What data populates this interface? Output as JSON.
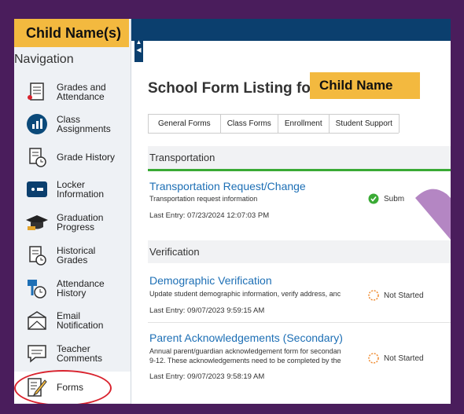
{
  "child_badge": "Child Name(s)",
  "nav": {
    "title": "Navigation",
    "items": [
      {
        "label": "Grades and Attendance",
        "icon": "grades-icon"
      },
      {
        "label": "Class Assignments",
        "icon": "class-assignments-icon"
      },
      {
        "label": "Grade History",
        "icon": "grade-history-icon"
      },
      {
        "label": "Locker Information",
        "icon": "locker-icon"
      },
      {
        "label": "Graduation Progress",
        "icon": "graduation-icon"
      },
      {
        "label": "Historical Grades",
        "icon": "historical-grades-icon"
      },
      {
        "label": "Attendance History",
        "icon": "attendance-history-icon"
      },
      {
        "label": "Email Notification",
        "icon": "email-icon"
      },
      {
        "label": "Teacher Comments",
        "icon": "comments-icon"
      },
      {
        "label": "Forms",
        "icon": "forms-icon",
        "active": true
      }
    ]
  },
  "page": {
    "title": "School Form Listing for",
    "child_name": "Child Name"
  },
  "tabs": [
    "General Forms",
    "Class Forms",
    "Enrollment",
    "Student Support"
  ],
  "sections": [
    {
      "name": "Transportation"
    },
    {
      "name": "Verification"
    }
  ],
  "forms": [
    {
      "title": "Transportation Request/Change",
      "desc": "Transportation request information",
      "last_entry": "Last Entry: 07/23/2024 12:07:03 PM",
      "status": "Subm"
    },
    {
      "title": "Demographic Verification",
      "desc": "Update student demographic information, verify address, anc",
      "last_entry": "Last Entry: 09/07/2023 9:59:15 AM",
      "status": "Not Started"
    },
    {
      "title": "Parent Acknowledgements (Secondary)",
      "desc": "Annual parent/guardian acknowledgement form for secondan",
      "desc2": "9-12. These acknowledgements need to be completed by the",
      "last_entry": "Last Entry: 09/07/2023 9:58:19 AM",
      "status": "Not Started"
    }
  ],
  "colors": {
    "accent": "#f3b93f",
    "frame": "#4a1d5c",
    "topbar": "#0b3f6e",
    "check": "#b07fc0",
    "link": "#1d6fb5",
    "submitted": "#3aaa35",
    "not_started": "#f08a2e",
    "highlight": "#d9232e"
  }
}
